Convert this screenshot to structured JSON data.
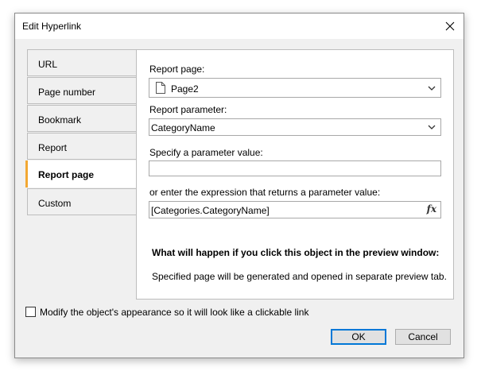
{
  "window": {
    "title": "Edit Hyperlink"
  },
  "tabs": [
    {
      "label": "URL"
    },
    {
      "label": "Page number"
    },
    {
      "label": "Bookmark"
    },
    {
      "label": "Report"
    },
    {
      "label": "Report page",
      "active": true
    },
    {
      "label": "Custom"
    }
  ],
  "form": {
    "report_page_label": "Report page:",
    "report_page_value": "Page2",
    "report_page_icon": "document-icon",
    "report_parameter_label": "Report parameter:",
    "report_parameter_value": "CategoryName",
    "param_value_label": "Specify a parameter value:",
    "param_value": "",
    "expression_label": "or enter the expression that returns a parameter value:",
    "expression_value": "[Categories.CategoryName]",
    "expression_button": "fx"
  },
  "info": {
    "heading": "What will happen if you click this object in the preview window:",
    "text": "Specified page will be generated and opened in separate preview tab."
  },
  "options": {
    "modify_appearance_label": "Modify the object's appearance so it will look like a clickable link",
    "modify_appearance_checked": false
  },
  "buttons": {
    "ok": "OK",
    "cancel": "Cancel"
  },
  "colors": {
    "active_tab_accent": "#f2a833",
    "default_button_border": "#0078d7"
  }
}
